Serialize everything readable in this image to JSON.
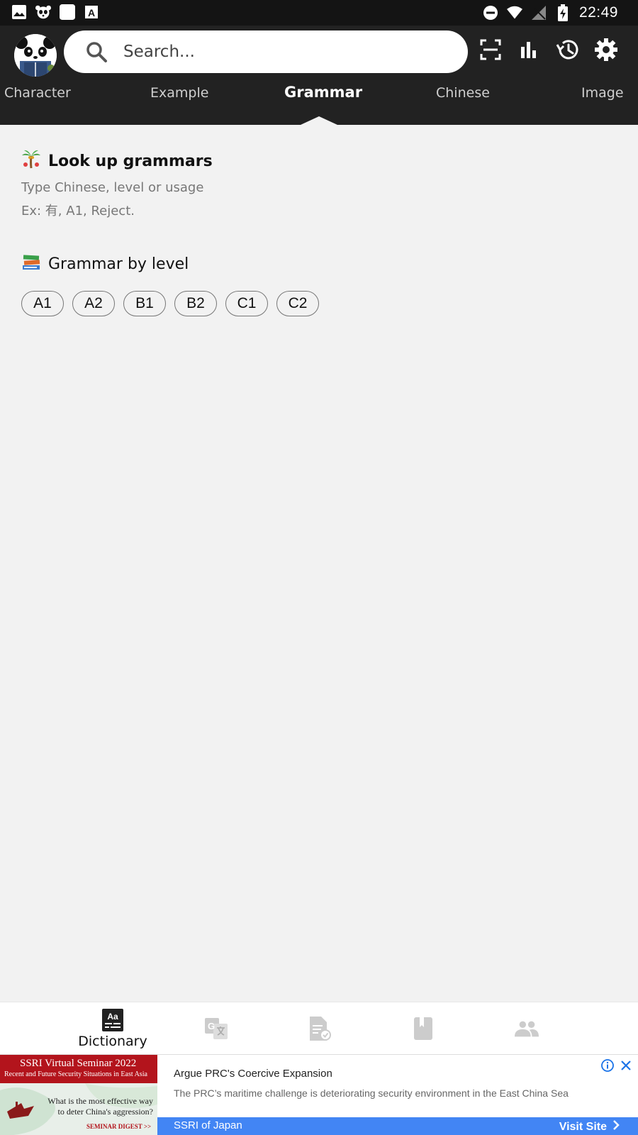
{
  "status_bar": {
    "time": "22:49",
    "icons": [
      "image-icon",
      "panda-notification-icon",
      "white-square-icon",
      "font-a-icon",
      "dnd-icon",
      "wifi-icon",
      "no-signal-icon",
      "battery-charging-icon"
    ]
  },
  "header": {
    "search_placeholder": "Search...",
    "actions": [
      "scan-icon",
      "stats-icon",
      "history-icon",
      "settings-icon"
    ],
    "tabs": [
      {
        "label": "Character"
      },
      {
        "label": "Example"
      },
      {
        "label": "Grammar",
        "active": true
      },
      {
        "label": "Chinese"
      },
      {
        "label": "Image"
      }
    ]
  },
  "content": {
    "lookup": {
      "title": "Look up grammars",
      "hint_line1": "Type Chinese, level or usage",
      "hint_line2": "Ex: 有, A1, Reject."
    },
    "by_level": {
      "title": "Grammar by level",
      "levels": [
        "A1",
        "A2",
        "B1",
        "B2",
        "C1",
        "C2"
      ]
    }
  },
  "bottom_nav": {
    "items": [
      {
        "label": "Dictionary",
        "icon": "dictionary-icon",
        "active": true
      },
      {
        "label": "",
        "icon": "translate-icon"
      },
      {
        "label": "",
        "icon": "test-icon"
      },
      {
        "label": "",
        "icon": "notebook-icon"
      },
      {
        "label": "",
        "icon": "community-icon"
      }
    ]
  },
  "ad": {
    "image_title": "SSRI Virtual Seminar 2022",
    "image_subtitle": "Recent and Future Security Situations in East Asia",
    "image_question": "What is the most effective way to deter China's aggression?",
    "image_footer": "SEMINAR DIGEST >>",
    "headline": "Argue PRC's Coercive Expansion",
    "description": "The PRC’s maritime challenge is deteriorating security environment in the East China Sea",
    "advertiser": "SSRI of Japan",
    "cta": "Visit Site"
  },
  "colors": {
    "header_bg": "#222222",
    "status_bg": "#141414",
    "content_bg": "#f2f2f2",
    "ad_bar": "#4285f4",
    "ad_red": "#b3141c"
  }
}
